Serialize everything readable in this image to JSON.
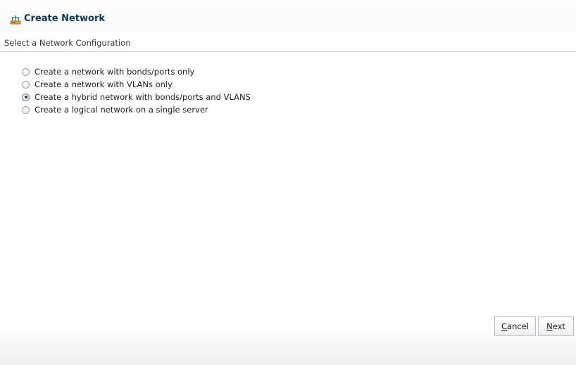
{
  "dialog": {
    "title": "Create Network",
    "icon": "network-icon"
  },
  "section": {
    "header": "Select a Network Configuration"
  },
  "options": [
    {
      "label": "Create a network with bonds/ports only",
      "checked": false
    },
    {
      "label": "Create a network with VLANs only",
      "checked": false
    },
    {
      "label": "Create a hybrid network with bonds/ports and VLANS",
      "checked": true
    },
    {
      "label": "Create a logical network on a single server",
      "checked": false
    }
  ],
  "buttons": {
    "cancel": {
      "mnemonic": "C",
      "rest": "ancel"
    },
    "next": {
      "mnemonic": "N",
      "rest": "ext"
    }
  },
  "colors": {
    "title": "#0a3a60",
    "divider": "#c9ced4",
    "radio_dot": "#1c3a56"
  }
}
